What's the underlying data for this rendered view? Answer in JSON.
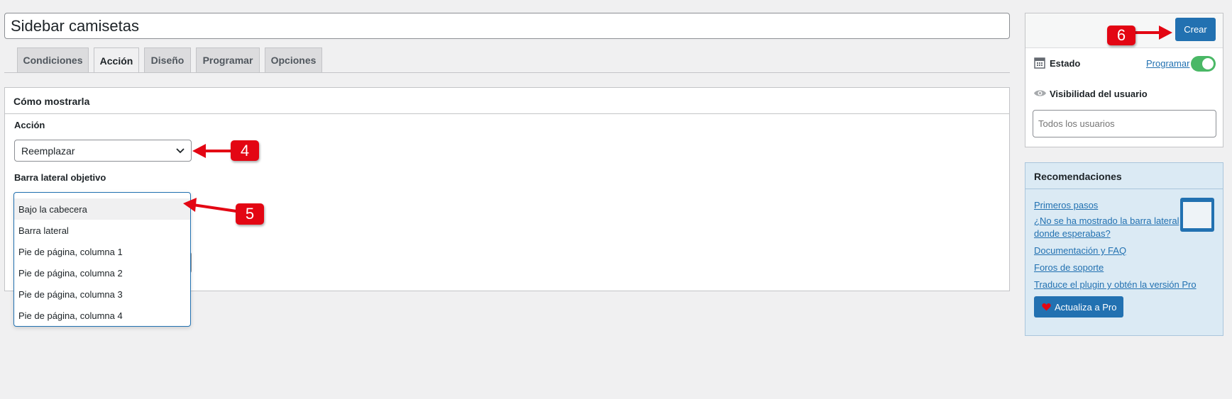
{
  "post_title": "Sidebar camisetas",
  "tabs": [
    {
      "label": "Condiciones"
    },
    {
      "label": "Acción"
    },
    {
      "label": "Diseño"
    },
    {
      "label": "Programar"
    },
    {
      "label": "Opciones"
    }
  ],
  "panel": {
    "title": "Cómo mostrarla",
    "action_label": "Acción",
    "action_value": "Reemplazar",
    "target_label": "Barra lateral objetivo",
    "dropdown_options": [
      "Bajo la cabecera",
      "Barra lateral",
      "Pie de página, columna 1",
      "Pie de página, columna 2",
      "Pie de página, columna 3",
      "Pie de página, columna 4"
    ]
  },
  "publish": {
    "create_label": "Crear",
    "status_label": "Estado",
    "schedule_link": "Programar",
    "visibility_label": "Visibilidad del usuario",
    "visibility_value": "Todos los usuarios"
  },
  "recommendations": {
    "title": "Recomendaciones",
    "links": [
      "Primeros pasos",
      "¿No se ha mostrado la barra lateral donde esperabas?",
      "Documentación y FAQ",
      "Foros de soporte",
      "Traduce el plugin y obtén la versión Pro"
    ],
    "pro_button": "Actualiza a Pro"
  },
  "annotations": [
    "4",
    "5",
    "6"
  ],
  "colors": {
    "accent": "#2271b1",
    "toggle_on": "#4ab866",
    "annotation": "#e30613"
  }
}
